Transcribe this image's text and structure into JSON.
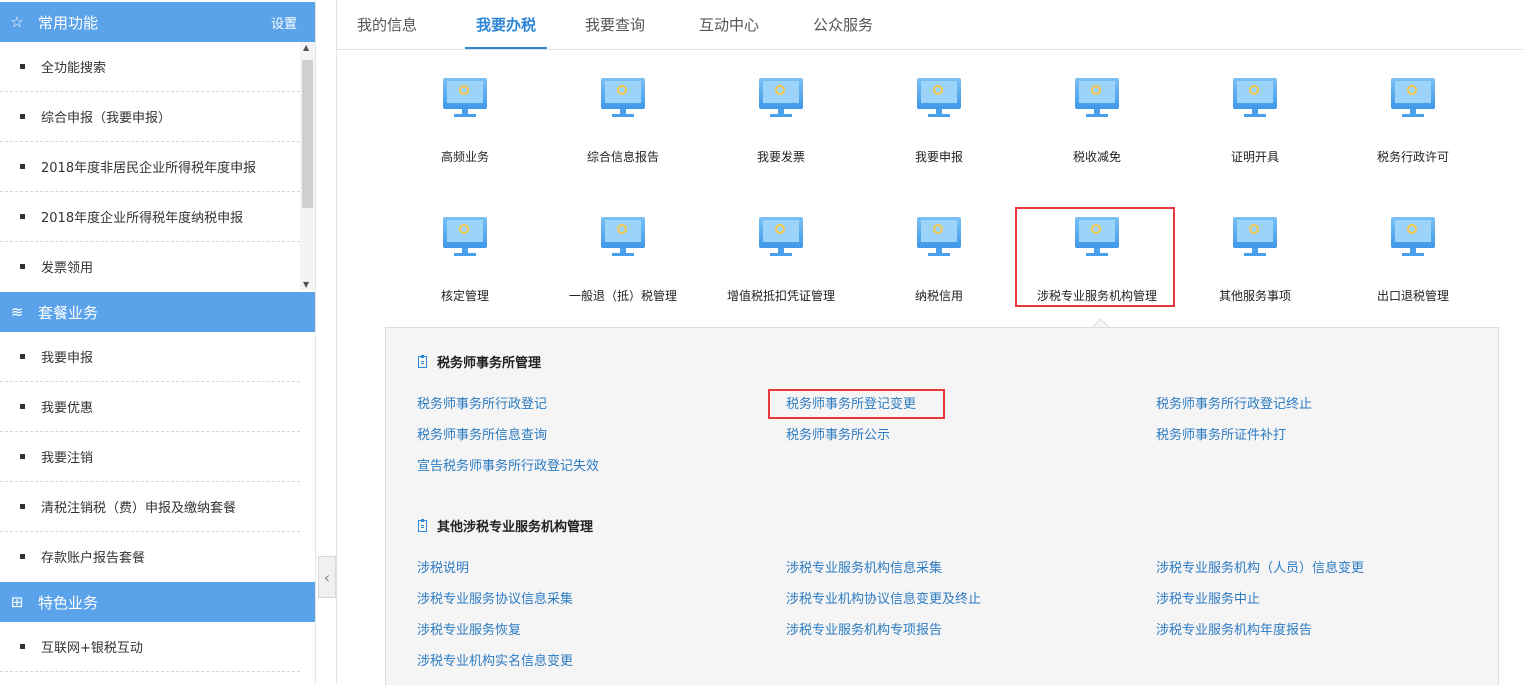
{
  "sidebar": {
    "sections": [
      {
        "title": "常用功能",
        "icon": "star-icon",
        "setting": "设置",
        "items": [
          "全功能搜索",
          "综合申报（我要申报）",
          "2018年度非居民企业所得税年度申报",
          "2018年度企业所得税年度纳税申报",
          "发票领用"
        ]
      },
      {
        "title": "套餐业务",
        "icon": "layers-icon",
        "items": [
          "我要申报",
          "我要优惠",
          "我要注销",
          "清税注销税（费）申报及缴纳套餐",
          "存款账户报告套餐"
        ]
      },
      {
        "title": "特色业务",
        "icon": "grid-icon",
        "items": [
          "互联网+银税互动"
        ]
      }
    ]
  },
  "tabs": [
    "我的信息",
    "我要办税",
    "我要查询",
    "互动中心",
    "公众服务"
  ],
  "active_tab": "我要办税",
  "services": {
    "row1": [
      "高频业务",
      "综合信息报告",
      "我要发票",
      "我要申报",
      "税收减免",
      "证明开具",
      "税务行政许可"
    ],
    "row2": [
      "核定管理",
      "一般退（抵）税管理",
      "增值税抵扣凭证管理",
      "纳税信用",
      "涉税专业服务机构管理",
      "其他服务事项",
      "出口退税管理"
    ],
    "selected": "涉税专业服务机构管理"
  },
  "panel": {
    "group1": {
      "title": "税务师事务所管理",
      "links": [
        "税务师事务所行政登记",
        "税务师事务所登记变更",
        "税务师事务所行政登记终止",
        "税务师事务所信息查询",
        "税务师事务所公示",
        "税务师事务所证件补打",
        "宣告税务师事务所行政登记失效"
      ]
    },
    "group2": {
      "title": "其他涉税专业服务机构管理",
      "links": [
        "涉税说明",
        "涉税专业服务机构信息采集",
        "涉税专业服务机构（人员）信息变更",
        "涉税专业服务协议信息采集",
        "涉税专业机构协议信息变更及终止",
        "涉税专业服务中止",
        "涉税专业服务恢复",
        "涉税专业服务机构专项报告",
        "涉税专业服务机构年度报告",
        "涉税专业机构实名信息变更"
      ]
    },
    "highlighted_link": "税务师事务所登记变更"
  },
  "colors": {
    "accent": "#2d86d8",
    "sidebar_header": "#5aa2ea",
    "highlight": "#e8383d",
    "link": "#2d7bc2"
  }
}
